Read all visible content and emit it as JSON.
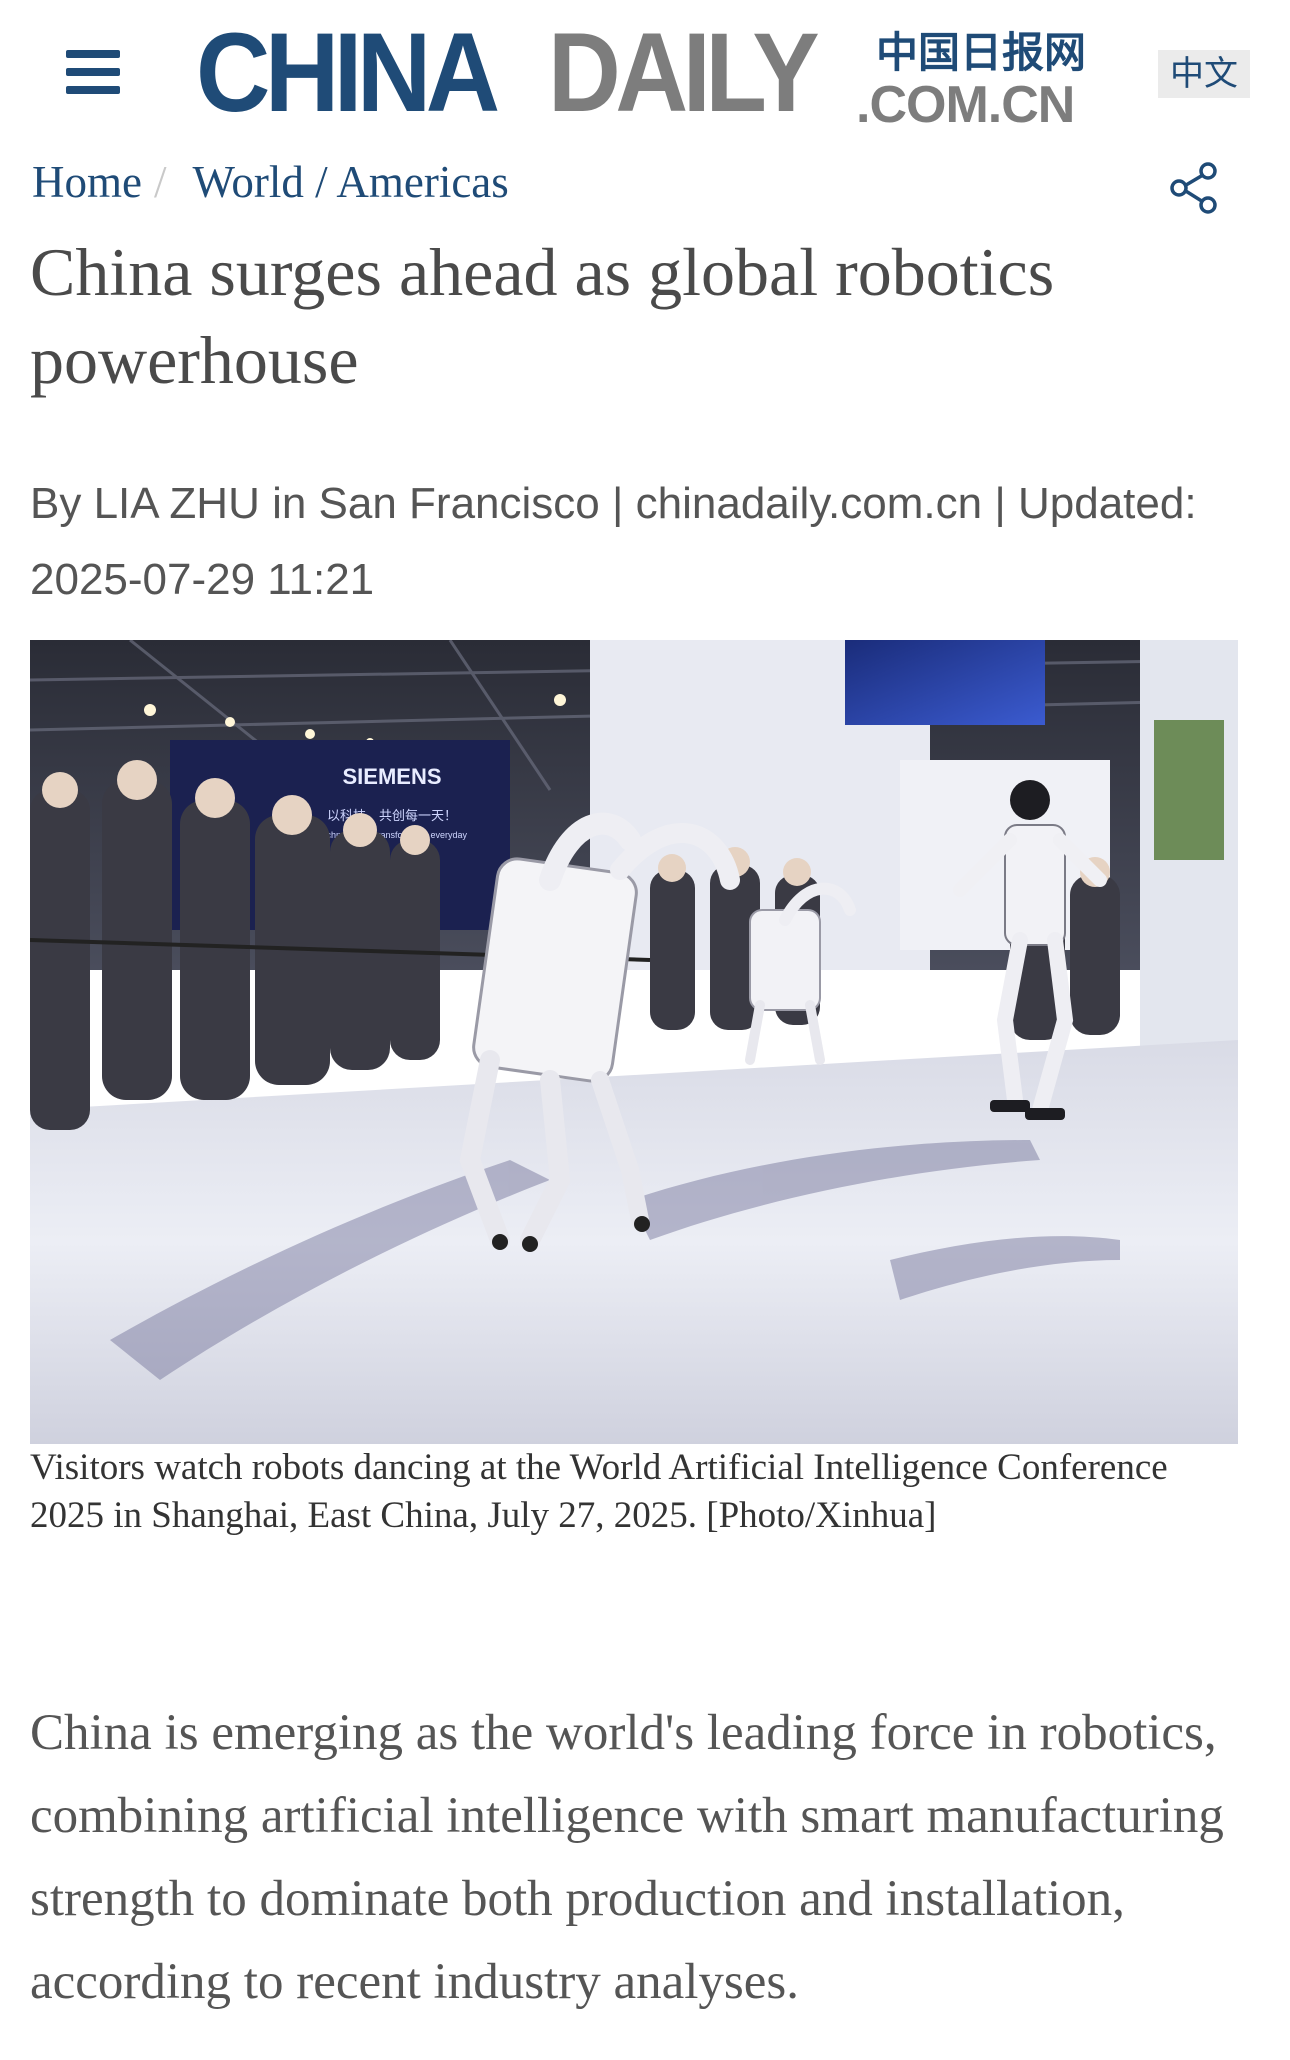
{
  "header": {
    "menu_icon": "hamburger-menu-icon",
    "logo": {
      "china": "CHINA",
      "daily": "DAILY",
      "chinese": "中国日报网",
      "domain": ".COM.CN"
    },
    "language_button": "中文"
  },
  "breadcrumb": {
    "home": "Home",
    "separator": "/",
    "section": "World / Americas"
  },
  "share_icon": "share-icon",
  "article": {
    "title": "China surges ahead as global robotics powerhouse",
    "byline": "By LIA ZHU in San Francisco | chinadaily.com.cn | Updated: 2025-07-29 11:21",
    "photo_signage": {
      "booth_brand": "SIEMENS",
      "booth_slogan_cn": "以科技，共创每一天！",
      "booth_slogan_en": "Technology to transform the everyday"
    },
    "photo_caption": "Visitors watch robots dancing at the World Artificial Intelligence Conference 2025 in Shanghai, East China, July 27, 2025. [Photo/Xinhua]",
    "lead_paragraph": "China is emerging as the world's leading force in robotics, combining artificial intelligence with smart manufacturing strength to dominate both production and installation, according to recent industry analyses."
  },
  "colors": {
    "brand_blue": "#1f4b77",
    "logo_gray": "#7d7d7d",
    "headline_gray": "#4a4a4a",
    "body_gray": "#555555"
  }
}
